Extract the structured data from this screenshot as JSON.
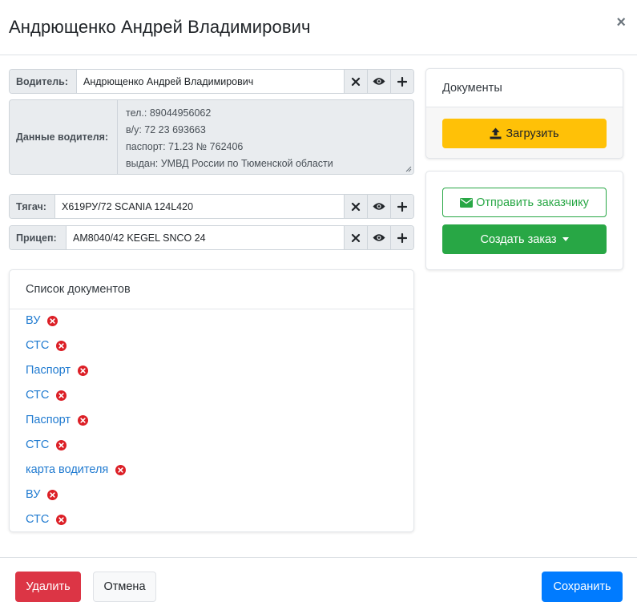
{
  "modal": {
    "title": "Андрющенко Андрей Владимирович",
    "close_glyph": "×"
  },
  "driver": {
    "label": "Водитель:",
    "value": "Андрющенко Андрей  Владимирович"
  },
  "driver_data": {
    "label": "Данные водителя:",
    "lines": [
      "тел.: 89044956062",
      "в/у: 72 23 693663",
      "паспорт: 71.23 № 762406",
      "выдан: УМВД России по Тюменской области"
    ]
  },
  "tractor": {
    "label": "Тягач:",
    "value": "Х619РУ/72 SCANIA 124L420"
  },
  "trailer": {
    "label": "Прицеп:",
    "value": "АМ8040/42 KEGEL SNCO 24"
  },
  "doc_list": {
    "title": "Список документов",
    "items": [
      "ВУ",
      "СТС",
      "Паспорт",
      "СТС",
      "Паспорт",
      "СТС",
      "карта водителя",
      "ВУ",
      "СТС"
    ]
  },
  "documents_card": {
    "title": "Документы",
    "upload_label": "Загрузить"
  },
  "actions_card": {
    "send_label": "Отправить заказчику",
    "create_label": "Создать заказ"
  },
  "footer": {
    "delete_label": "Удалить",
    "cancel_label": "Отмена",
    "save_label": "Сохранить"
  },
  "colors": {
    "primary": "#007bff",
    "success": "#28a745",
    "warning": "#ffc107",
    "danger": "#dc3545",
    "link": "#1f7ad0",
    "remove_icon": "#dc1f26"
  },
  "icons": {
    "clear": "x-icon",
    "view": "eye-icon",
    "add": "plus-icon",
    "upload": "upload-icon",
    "send": "envelope-icon",
    "dropdown": "caret-down-icon",
    "remove": "circle-x-icon"
  }
}
